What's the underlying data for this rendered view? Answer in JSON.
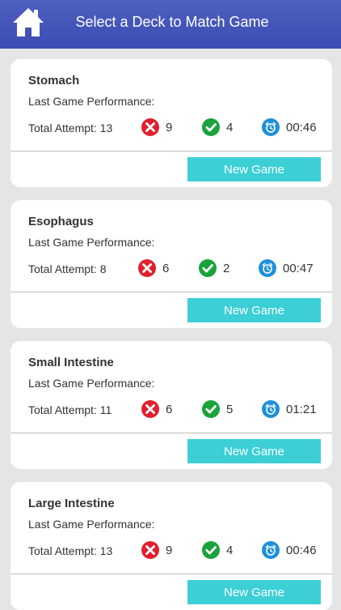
{
  "header": {
    "title": "Select a Deck to Match Game",
    "home_icon": "home-icon",
    "color": "#4354b8"
  },
  "colors": {
    "wrong": "#e0202f",
    "correct": "#1aa33a",
    "time": "#1f8fd9",
    "button": "#3ccfd6"
  },
  "decks": [
    {
      "name": "Stomach",
      "perf_label": "Last Game Performance:",
      "attempts": "Total Attempt: 13",
      "wrong": "9",
      "correct": "4",
      "time": "00:46",
      "button": "New Game"
    },
    {
      "name": "Esophagus",
      "perf_label": "Last Game Performance:",
      "attempts": "Total Attempt: 8",
      "wrong": "6",
      "correct": "2",
      "time": "00:47",
      "button": "New Game"
    },
    {
      "name": "Small Intestine",
      "perf_label": "Last Game Performance:",
      "attempts": "Total Attempt: 11",
      "wrong": "6",
      "correct": "5",
      "time": "01:21",
      "button": "New Game"
    },
    {
      "name": "Large Intestine",
      "perf_label": "Last Game Performance:",
      "attempts": "Total Attempt: 13",
      "wrong": "9",
      "correct": "4",
      "time": "00:46",
      "button": "New Game"
    }
  ]
}
